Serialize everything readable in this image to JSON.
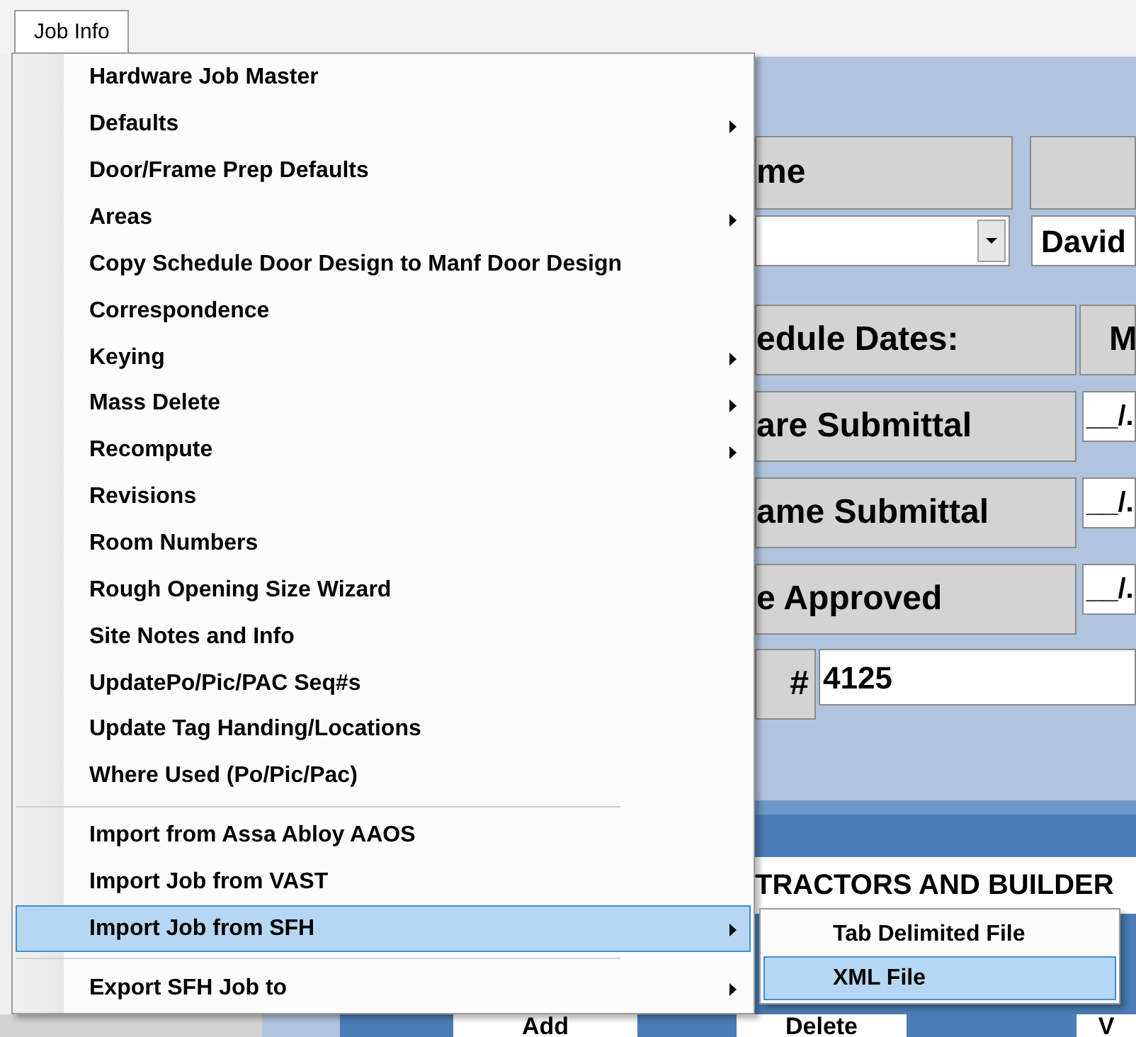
{
  "menu_bar": [
    {
      "label": "Job Info",
      "selected": true
    }
  ],
  "menu": [
    {
      "kind": "item",
      "label": "Hardware Job Master",
      "submenu": false,
      "selected": false
    },
    {
      "kind": "item",
      "label": "Defaults",
      "submenu": true,
      "selected": false
    },
    {
      "kind": "item",
      "label": "Door/Frame Prep Defaults",
      "submenu": false,
      "selected": false
    },
    {
      "kind": "item",
      "label": "Areas",
      "submenu": true,
      "selected": false
    },
    {
      "kind": "item",
      "label": "Copy Schedule Door Design to Manf Door Design",
      "submenu": false,
      "selected": false
    },
    {
      "kind": "item",
      "label": "Correspondence",
      "submenu": false,
      "selected": false
    },
    {
      "kind": "item",
      "label": "Keying",
      "submenu": true,
      "selected": false
    },
    {
      "kind": "item",
      "label": "Mass Delete",
      "submenu": true,
      "selected": false
    },
    {
      "kind": "item",
      "label": "Recompute",
      "submenu": true,
      "selected": false
    },
    {
      "kind": "item",
      "label": "Revisions",
      "submenu": false,
      "selected": false
    },
    {
      "kind": "item",
      "label": "Room Numbers",
      "submenu": false,
      "selected": false
    },
    {
      "kind": "item",
      "label": "Rough Opening Size Wizard",
      "submenu": false,
      "selected": false
    },
    {
      "kind": "item",
      "label": "Site Notes and Info",
      "submenu": false,
      "selected": false
    },
    {
      "kind": "item",
      "label": "UpdatePo/Pic/PAC Seq#s",
      "submenu": false,
      "selected": false
    },
    {
      "kind": "item",
      "label": "Update Tag Handing/Locations",
      "submenu": false,
      "selected": false
    },
    {
      "kind": "item",
      "label": "Where Used (Po/Pic/Pac)",
      "submenu": false,
      "selected": false
    },
    {
      "kind": "separator"
    },
    {
      "kind": "item",
      "label": "Import from Assa Abloy AAOS",
      "submenu": false,
      "selected": false
    },
    {
      "kind": "item",
      "label": "Import Job from VAST",
      "submenu": false,
      "selected": false
    },
    {
      "kind": "item",
      "label": "Import Job from SFH",
      "submenu": true,
      "selected": true
    },
    {
      "kind": "separator"
    },
    {
      "kind": "item",
      "label": "Export SFH Job to",
      "submenu": true,
      "selected": false
    }
  ],
  "submenu": [
    {
      "label": "Tab Delimited File",
      "selected": false
    },
    {
      "label": "XML File",
      "selected": true
    }
  ],
  "form": {
    "name_label": "me",
    "name_field": "David",
    "schedule_header": "edule Dates:",
    "schedule_header_2": "M",
    "date_rows": [
      {
        "label": "are Submittal",
        "value": "__/."
      },
      {
        "label": "ame Submittal",
        "value": "__/."
      },
      {
        "label": "e Approved",
        "value": "__/."
      }
    ],
    "number_label": "#",
    "number_value": "4125",
    "section_title": "TRACTORS AND BUILDER",
    "buttons": [
      "Add",
      "Delete",
      "V"
    ]
  }
}
